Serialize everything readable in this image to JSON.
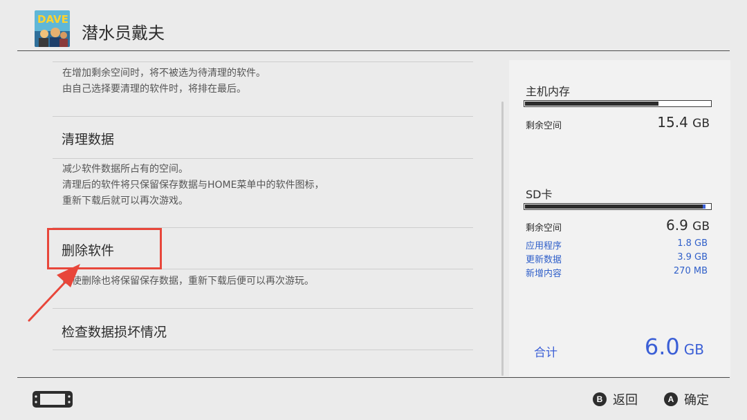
{
  "header": {
    "app_title": "潜水员戴夫",
    "app_icon": "game-cover-icon",
    "app_icon_text": "DAVE"
  },
  "options": {
    "archive_desc_line1": "在增加剩余空间时，将不被选为待清理的软件。",
    "archive_desc_line2": "由自己选择要清理的软件时，将排在最后。",
    "archive_data_title": "清理数据",
    "archive_data_desc_line1": "减少软件数据所占有的空间。",
    "archive_data_desc_line2": "清理后的软件将只保留保存数据与HOME菜单中的软件图标，",
    "archive_data_desc_line3": "重新下载后就可以再次游戏。",
    "delete_title": "删除软件",
    "delete_desc": "即使删除也将保留保存数据，重新下载后便可以再次游玩。",
    "check_title": "检查数据损坏情况"
  },
  "storage": {
    "system": {
      "label": "主机内存",
      "free_label": "剩余空间",
      "free_value": "15.4",
      "free_unit": "GB",
      "used_fraction": 0.72
    },
    "sd": {
      "label": "SD卡",
      "free_label": "剩余空间",
      "free_value": "6.9",
      "free_unit": "GB",
      "used_fraction": 0.975,
      "rows": [
        {
          "label": "应用程序",
          "value": "1.8 GB"
        },
        {
          "label": "更新数据",
          "value": "3.9 GB"
        },
        {
          "label": "新增内容",
          "value": "270 MB"
        }
      ]
    },
    "total_label": "合计",
    "total_value": "6.0",
    "total_unit": "GB"
  },
  "footer": {
    "console_icon": "handheld-console-icon",
    "back_button_glyph": "B",
    "back_label": "返回",
    "confirm_button_glyph": "A",
    "confirm_label": "确定"
  },
  "colors": {
    "accent_blue": "#3b5fd6",
    "annotation_red": "#e8463a",
    "sd_bar_accent": "#3b5fd6"
  }
}
